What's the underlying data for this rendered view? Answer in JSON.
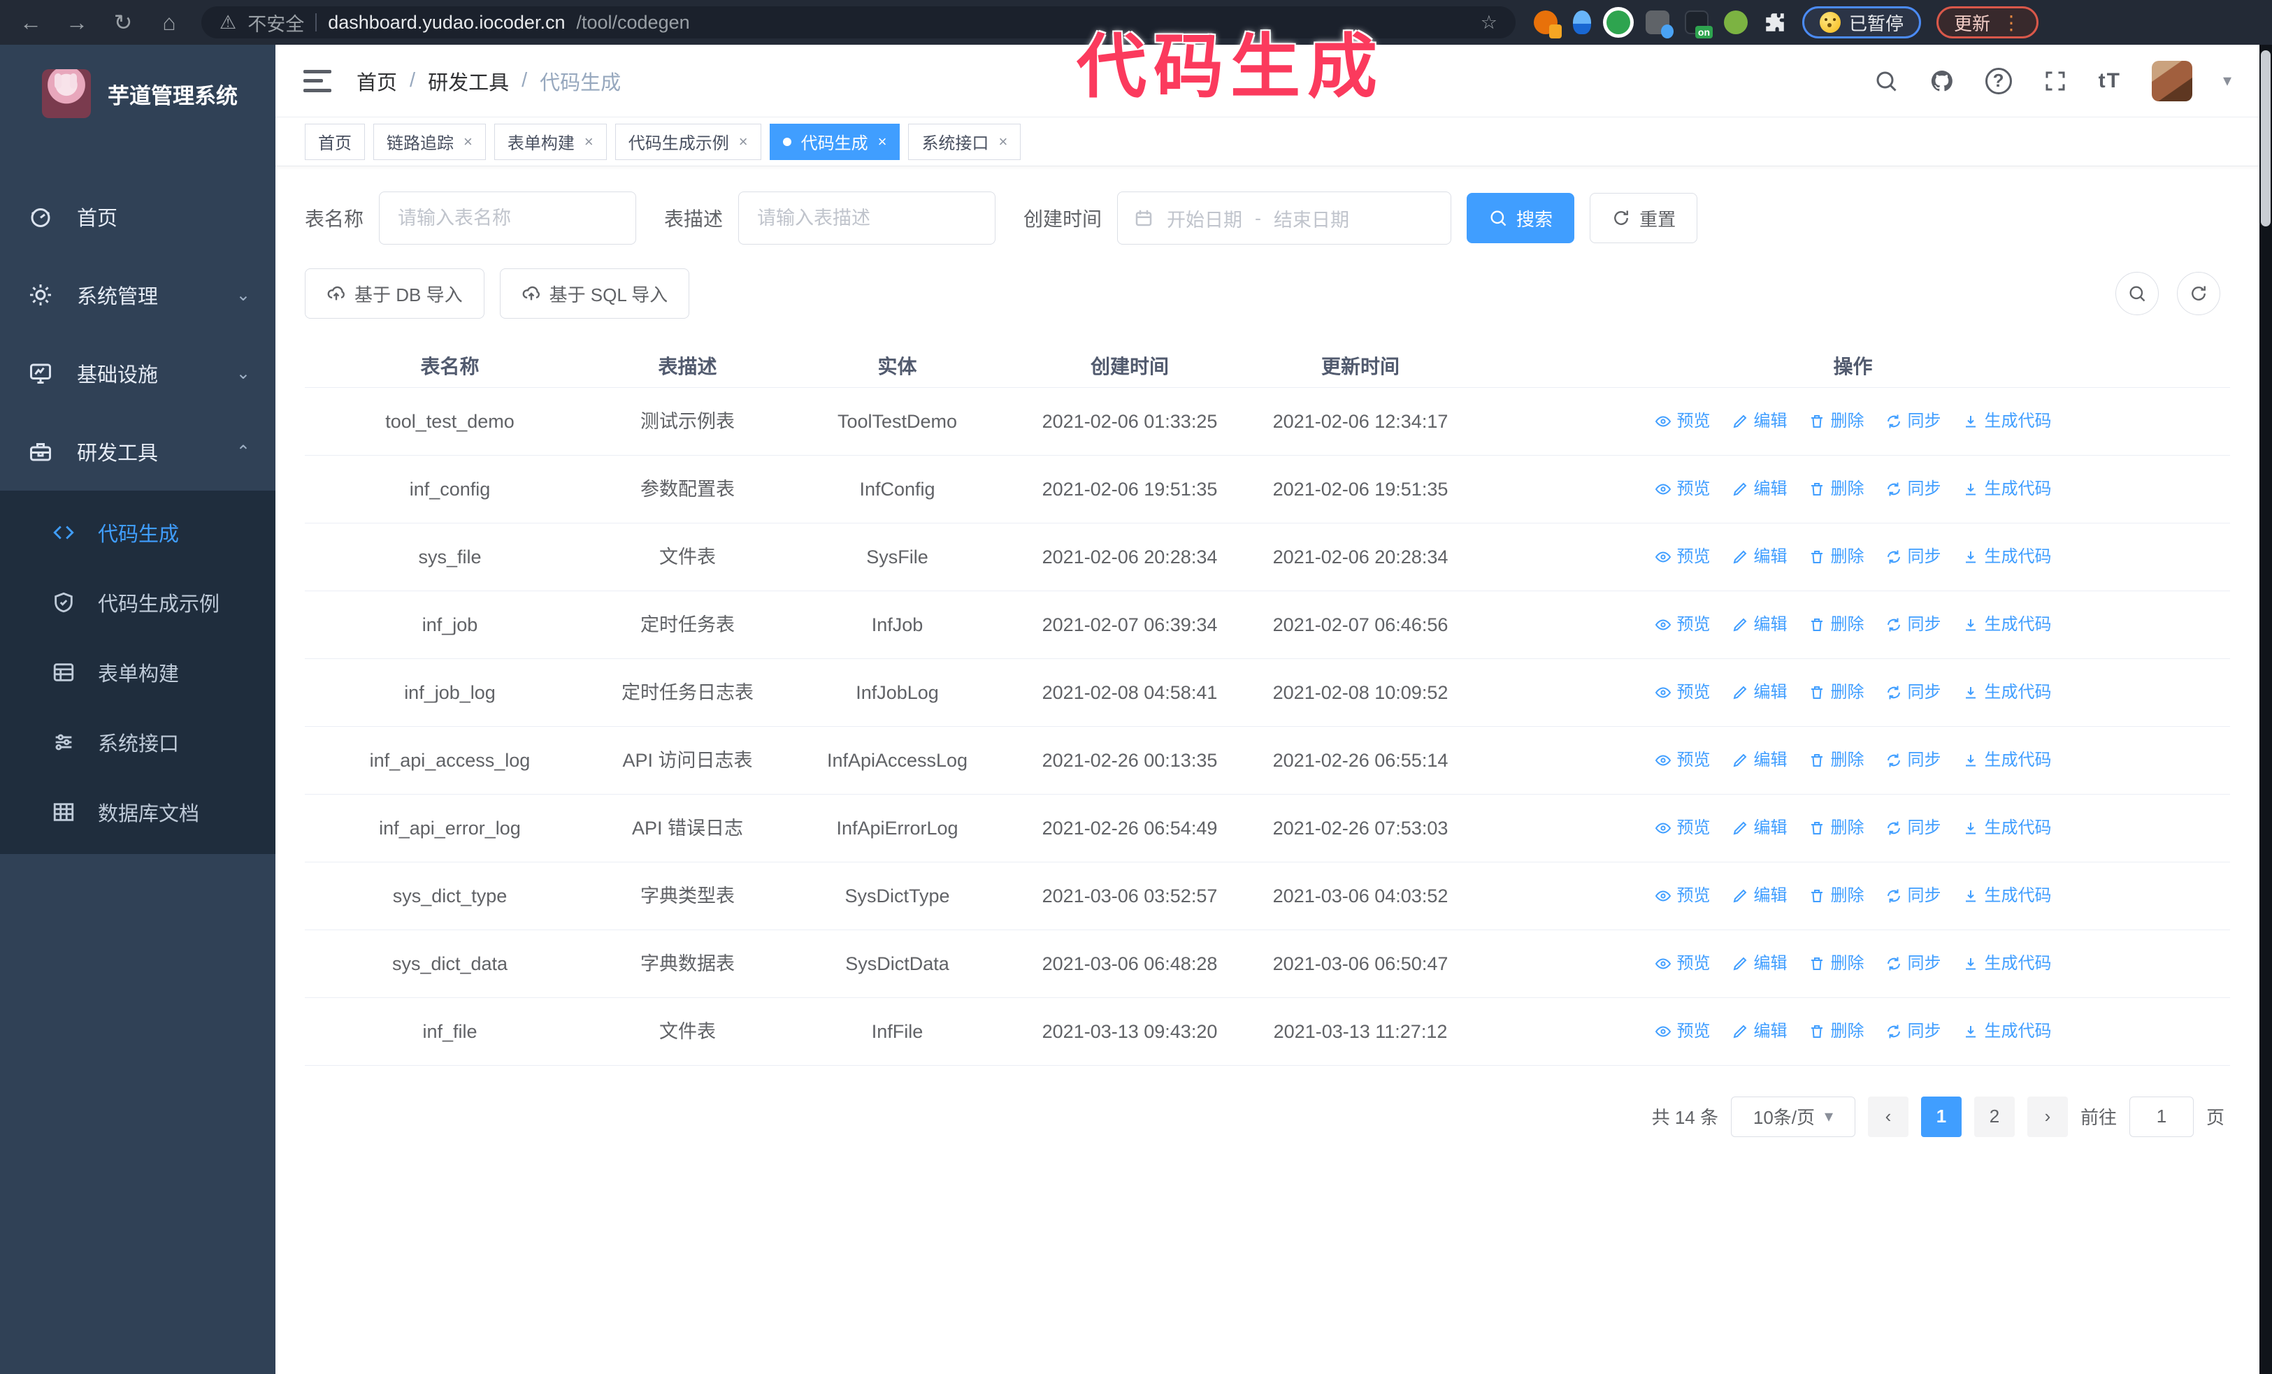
{
  "browser": {
    "security_warning": "不安全",
    "url_host": "dashboard.yudao.iocoder.cn",
    "url_path": "/tool/codegen",
    "paused_badge": "已暂停",
    "update_button": "更新",
    "extension_on_badge": "on"
  },
  "annotation": {
    "text": "代码生成",
    "color": "#fb3a5d"
  },
  "sidebar": {
    "app_title": "芋道管理系统",
    "items": [
      {
        "label": "首页"
      },
      {
        "label": "系统管理"
      },
      {
        "label": "基础设施"
      },
      {
        "label": "研发工具"
      }
    ],
    "submenu": [
      {
        "label": "代码生成"
      },
      {
        "label": "代码生成示例"
      },
      {
        "label": "表单构建"
      },
      {
        "label": "系统接口"
      },
      {
        "label": "数据库文档"
      }
    ]
  },
  "breadcrumb": {
    "home": "首页",
    "section": "研发工具",
    "current": "代码生成"
  },
  "tabs": [
    {
      "label": "首页"
    },
    {
      "label": "链路追踪"
    },
    {
      "label": "表单构建"
    },
    {
      "label": "代码生成示例"
    },
    {
      "label": "代码生成"
    },
    {
      "label": "系统接口"
    }
  ],
  "filters": {
    "table_name_label": "表名称",
    "table_name_placeholder": "请输入表名称",
    "table_desc_label": "表描述",
    "table_desc_placeholder": "请输入表描述",
    "create_time_label": "创建时间",
    "date_start_placeholder": "开始日期",
    "date_separator": "-",
    "date_end_placeholder": "结束日期",
    "search_button": "搜索",
    "reset_button": "重置"
  },
  "toolbar": {
    "import_db_button": "基于 DB 导入",
    "import_sql_button": "基于 SQL 导入"
  },
  "table": {
    "columns": {
      "name": "表名称",
      "desc": "表描述",
      "entity": "实体",
      "created": "创建时间",
      "updated": "更新时间",
      "actions": "操作"
    },
    "action_labels": {
      "preview": "预览",
      "edit": "编辑",
      "delete": "删除",
      "sync": "同步",
      "generate": "生成代码"
    },
    "rows": [
      {
        "name": "tool_test_demo",
        "desc": "测试示例表",
        "entity": "ToolTestDemo",
        "created": "2021-02-06 01:33:25",
        "updated": "2021-02-06 12:34:17"
      },
      {
        "name": "inf_config",
        "desc": "参数配置表",
        "entity": "InfConfig",
        "created": "2021-02-06 19:51:35",
        "updated": "2021-02-06 19:51:35"
      },
      {
        "name": "sys_file",
        "desc": "文件表",
        "entity": "SysFile",
        "created": "2021-02-06 20:28:34",
        "updated": "2021-02-06 20:28:34"
      },
      {
        "name": "inf_job",
        "desc": "定时任务表",
        "entity": "InfJob",
        "created": "2021-02-07 06:39:34",
        "updated": "2021-02-07 06:46:56"
      },
      {
        "name": "inf_job_log",
        "desc": "定时任务日志表",
        "entity": "InfJobLog",
        "created": "2021-02-08 04:58:41",
        "updated": "2021-02-08 10:09:52"
      },
      {
        "name": "inf_api_access_log",
        "desc": "API 访问日志表",
        "entity": "InfApiAccessLog",
        "created": "2021-02-26 00:13:35",
        "updated": "2021-02-26 06:55:14"
      },
      {
        "name": "inf_api_error_log",
        "desc": "API 错误日志",
        "entity": "InfApiErrorLog",
        "created": "2021-02-26 06:54:49",
        "updated": "2021-02-26 07:53:03"
      },
      {
        "name": "sys_dict_type",
        "desc": "字典类型表",
        "entity": "SysDictType",
        "created": "2021-03-06 03:52:57",
        "updated": "2021-03-06 04:03:52"
      },
      {
        "name": "sys_dict_data",
        "desc": "字典数据表",
        "entity": "SysDictData",
        "created": "2021-03-06 06:48:28",
        "updated": "2021-03-06 06:50:47"
      },
      {
        "name": "inf_file",
        "desc": "文件表",
        "entity": "InfFile",
        "created": "2021-03-13 09:43:20",
        "updated": "2021-03-13 11:27:12"
      }
    ]
  },
  "pagination": {
    "total_text": "共 14 条",
    "page_size": "10条/页",
    "page_1": "1",
    "page_2": "2",
    "goto_label": "前往",
    "goto_value": "1",
    "goto_suffix": "页"
  },
  "icons": {
    "back": "←",
    "forward": "→",
    "reload": "↻",
    "home": "⌂",
    "warning": "⚠",
    "star": "☆",
    "close": "×",
    "caret_down": "▾",
    "chev_down": "⌄",
    "chev_up": "⌃",
    "separator": "/",
    "dots": "⋮",
    "font_size": "tT",
    "question": "?"
  },
  "colors": {
    "primary": "#409eff",
    "sidebar_bg": "#304156",
    "submenu_bg": "#1f2d3d",
    "annotation": "#fb3a5d",
    "browser_bar": "#232a36"
  }
}
